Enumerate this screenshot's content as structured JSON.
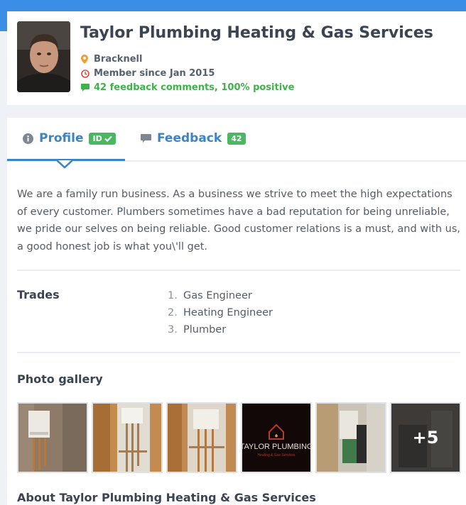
{
  "business": {
    "name": "Taylor Plumbing Heating & Gas Services",
    "location": "Bracknell",
    "member_since": "Member since Jan 2015",
    "feedback_summary": "42 feedback comments, 100% positive"
  },
  "tabs": [
    {
      "label": "Profile",
      "badge": "ID",
      "active": true
    },
    {
      "label": "Feedback",
      "badge": "42",
      "active": false
    }
  ],
  "profile": {
    "description": "We are a family run business. As a business we strive to meet the high expectations of every customer. Plumbers sometimes have a bad reputation for being unreliable, we pride our selves on being reliable. Good customer relations is a must, and with us, a good honest job is what you\\'ll get.",
    "trades_label": "Trades",
    "trades": [
      {
        "num": "1.",
        "name": "Gas Engineer"
      },
      {
        "num": "2.",
        "name": "Heating Engineer"
      },
      {
        "num": "3.",
        "name": "Plumber"
      }
    ],
    "gallery_label": "Photo gallery",
    "gallery_logo_text": "TAYLOR PLUMBING",
    "gallery_logo_sub": "Heating & Gas Services",
    "gallery_more": "+5",
    "about_title": "About Taylor Plumbing Heating & Gas Services"
  },
  "colors": {
    "accent": "#3a84c9",
    "positive": "#3fb24a",
    "badge": "#49b860"
  },
  "icons": {
    "location": "map-pin-icon",
    "member_since": "clock-icon",
    "feedback": "comment-icon",
    "profile_tab": "info-circle-icon",
    "feedback_tab": "comment-icon",
    "id_badge": "check-icon"
  }
}
